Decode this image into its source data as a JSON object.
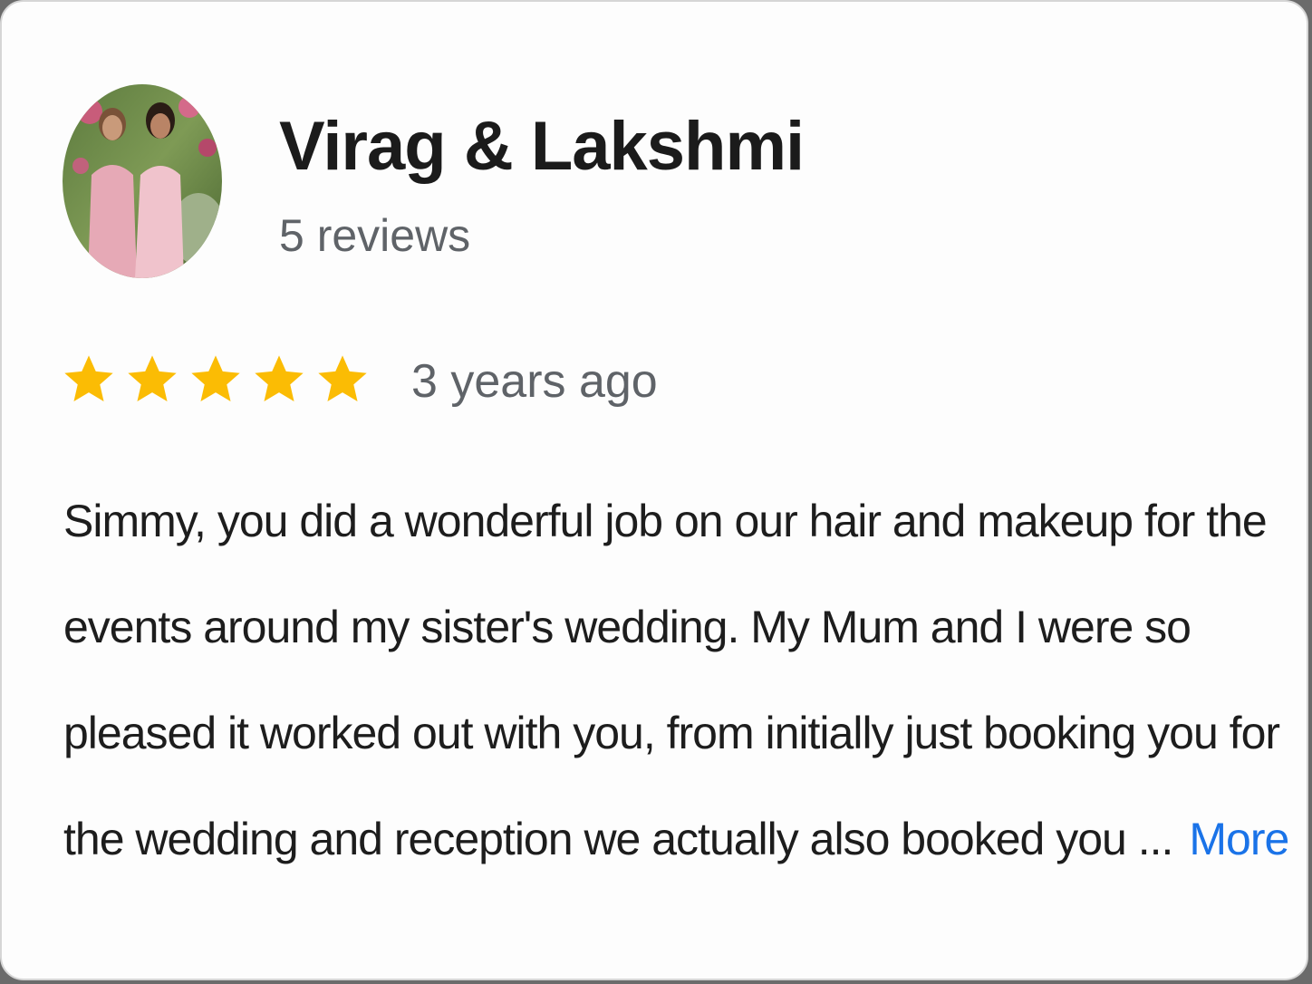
{
  "reviewer": {
    "name": "Virag & Lakshmi",
    "review_count": "5 reviews",
    "avatar_icon": "reviewer-photo"
  },
  "rating": {
    "stars": 5,
    "max_stars": 5,
    "star_color": "#fbbc04",
    "timestamp": "3 years ago"
  },
  "review": {
    "lines": [
      "Simmy, you did a wonderful job on our hair and makeup for the",
      "events around my sister's wedding. My Mum and I were so",
      "pleased it worked out with you, from initially just booking you for",
      "the wedding and reception we actually also booked you ..."
    ],
    "more_label": "More",
    "link_color": "#1a73e8"
  }
}
